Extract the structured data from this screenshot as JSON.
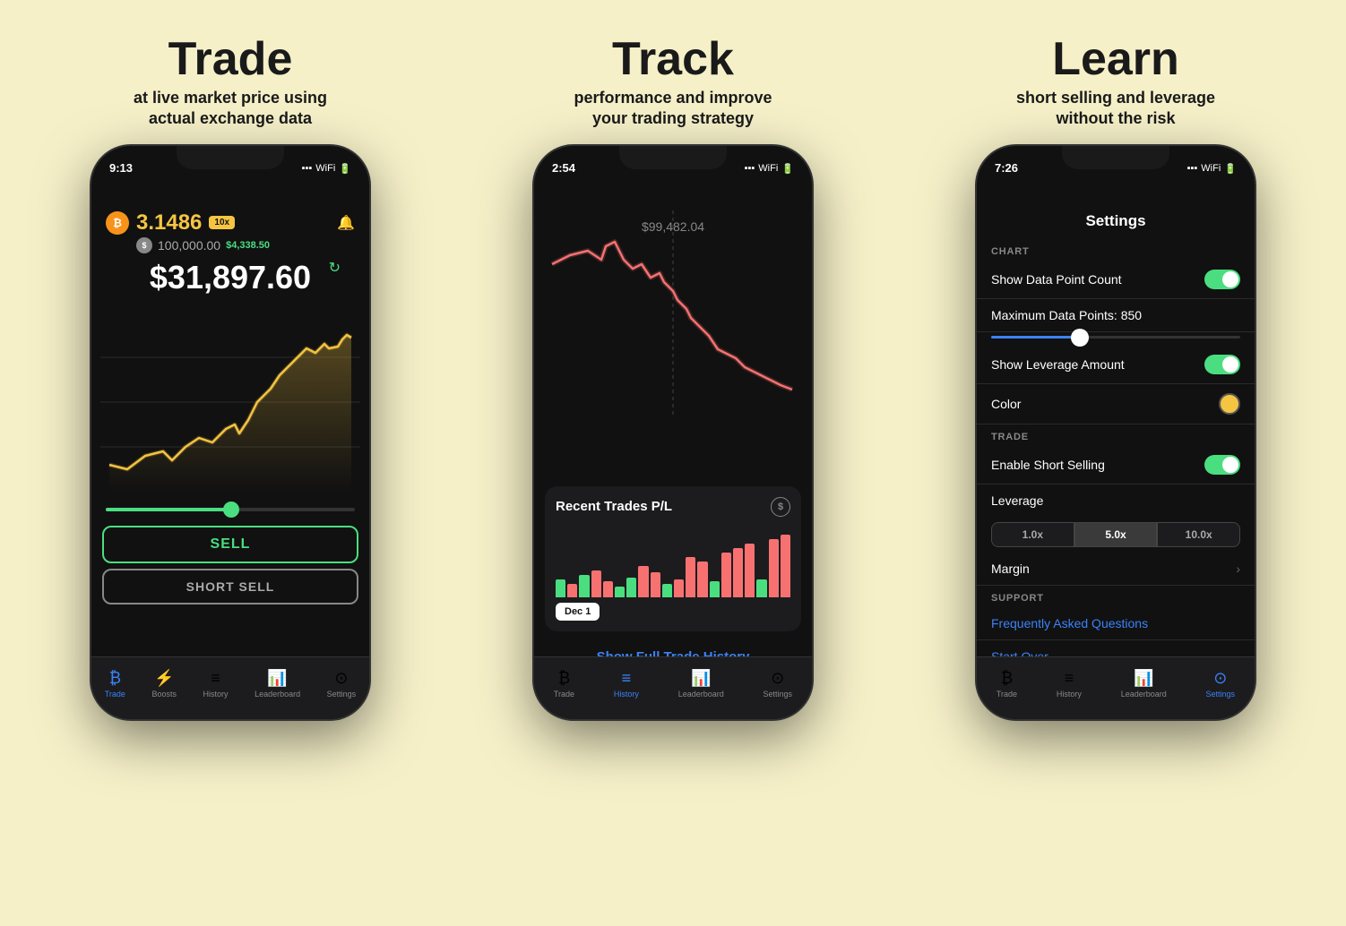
{
  "panels": [
    {
      "id": "trade",
      "title": "Trade",
      "subtitle": "at live market price using\nactual exchange data",
      "phone": {
        "status_time": "9:13",
        "btc_amount": "3.1486",
        "leverage": "10x",
        "usd_balance": "100,000.00",
        "profit": "$4,338.50",
        "main_price": "$31,897.60",
        "btn_sell": "SELL",
        "btn_short": "SHORT SELL",
        "tabs": [
          "Trade",
          "Boosts",
          "History",
          "Leaderboard",
          "Settings"
        ]
      }
    },
    {
      "id": "track",
      "title": "Track",
      "subtitle": "performance and improve\nyour trading strategy",
      "phone": {
        "status_time": "2:54",
        "chart_price": "$99,482.04",
        "recent_trades_title": "Recent Trades P/L",
        "date_label": "Dec 1",
        "show_history": "Show Full Trade History",
        "tabs": [
          "Trade",
          "History",
          "Leaderboard",
          "Settings"
        ]
      }
    },
    {
      "id": "learn",
      "title": "Learn",
      "subtitle": "short selling and leverage\nwithout the risk",
      "phone": {
        "status_time": "7:26",
        "settings_title": "Settings",
        "section_chart": "CHART",
        "show_data_point": "Show Data Point Count",
        "max_data_points": "Maximum Data Points: 850",
        "show_leverage": "Show Leverage Amount",
        "color_label": "Color",
        "section_trade": "TRADE",
        "enable_short": "Enable Short Selling",
        "leverage_label": "Leverage",
        "leverage_options": [
          "1.0x",
          "5.0x",
          "10.0x"
        ],
        "margin_label": "Margin",
        "section_support": "SUPPORT",
        "faq_label": "Frequently Asked Questions",
        "start_over": "Start Over",
        "tabs": [
          "Trade",
          "History",
          "Leaderboard",
          "Settings"
        ]
      }
    }
  ]
}
